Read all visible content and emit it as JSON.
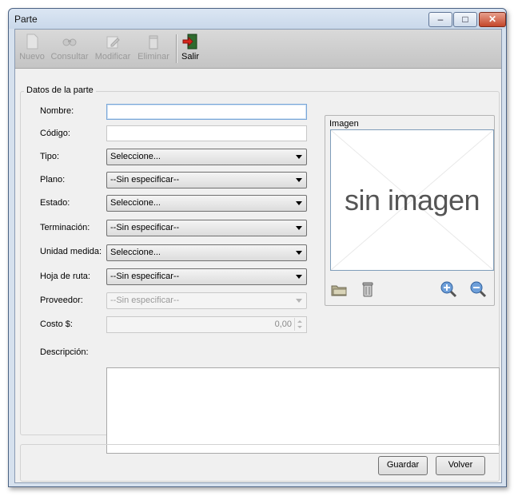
{
  "window": {
    "title": "Parte"
  },
  "toolbar": {
    "nuevo": "Nuevo",
    "consultar": "Consultar",
    "modificar": "Modificar",
    "eliminar": "Eliminar",
    "salir": "Salir"
  },
  "group": {
    "title": "Datos de la parte"
  },
  "fields": {
    "nombre": {
      "label": "Nombre:",
      "value": ""
    },
    "codigo": {
      "label": "Código:",
      "value": ""
    },
    "tipo": {
      "label": "Tipo:",
      "value": "Seleccione..."
    },
    "plano": {
      "label": "Plano:",
      "value": "--Sin especificar--"
    },
    "estado": {
      "label": "Estado:",
      "value": "Seleccione..."
    },
    "terminacion": {
      "label": "Terminación:",
      "value": "--Sin especificar--"
    },
    "unidad": {
      "label": "Unidad medida:",
      "value": "Seleccione..."
    },
    "hoja": {
      "label": "Hoja de ruta:",
      "value": "--Sin especificar--"
    },
    "proveedor": {
      "label": "Proveedor:",
      "value": "--Sin especificar--"
    },
    "costo": {
      "label": "Costo $:",
      "value": "0,00"
    },
    "descripcion": {
      "label": "Descripción:",
      "value": ""
    }
  },
  "image": {
    "title": "Imagen",
    "placeholder": "sin imagen"
  },
  "buttons": {
    "guardar": "Guardar",
    "volver": "Volver"
  },
  "colors": {
    "focus_border": "#7aa7d8",
    "title_bg": "#c9d8ea",
    "close": "#c4462a"
  }
}
